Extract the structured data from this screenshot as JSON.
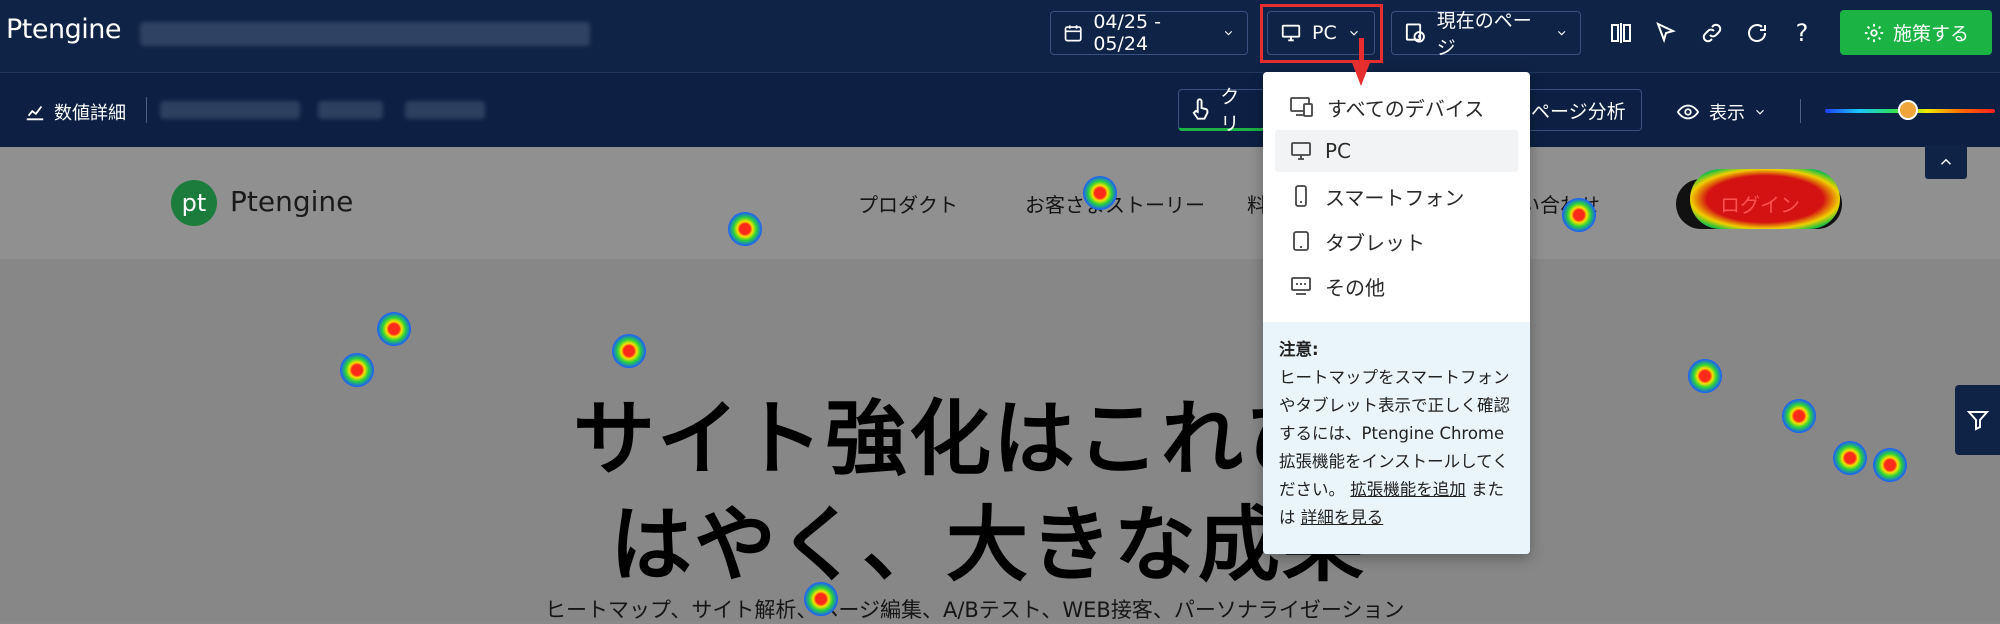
{
  "topbar": {
    "logo": "Ptengine",
    "date_range": "04/25 - 05/24",
    "device": "PC",
    "page_scope": "現在のページ",
    "cta": "施策する"
  },
  "subbar": {
    "metrics": "数値詳細",
    "click_tab": "クリ",
    "page_analysis": "ページ分析",
    "display": "表示"
  },
  "site": {
    "logo": "Ptengine",
    "nav": [
      "プロダクト",
      "お客さまストーリー",
      "料",
      "い合わせ"
    ],
    "login": "ログイン",
    "hero_line1": "サイト強化はこれひ",
    "hero_line2": "はやく、大きな成果",
    "hero_sub": "ヒートマップ、サイト解析、ページ編集、A/Bテスト、WEB接客、パーソナライゼーション"
  },
  "device_menu": {
    "items": [
      {
        "label": "すべてのデバイス",
        "icon": "devices-icon"
      },
      {
        "label": "PC",
        "icon": "monitor-icon"
      },
      {
        "label": "スマートフォン",
        "icon": "smartphone-icon"
      },
      {
        "label": "タブレット",
        "icon": "tablet-icon"
      },
      {
        "label": "その他",
        "icon": "other-device-icon"
      }
    ],
    "selected": "PC",
    "note_title": "注意:",
    "note_text": "ヒートマップをスマートフォンやタブレット表示で正しく確認するには、Ptengine Chrome拡張機能をインストールしてください。",
    "note_link1": "拡張機能を追加",
    "note_or": "または",
    "note_link2": "詳細を見る"
  },
  "colors": {
    "topbar": "#0f2347",
    "cta": "#1ab344",
    "highlight": "#e62e2e"
  }
}
